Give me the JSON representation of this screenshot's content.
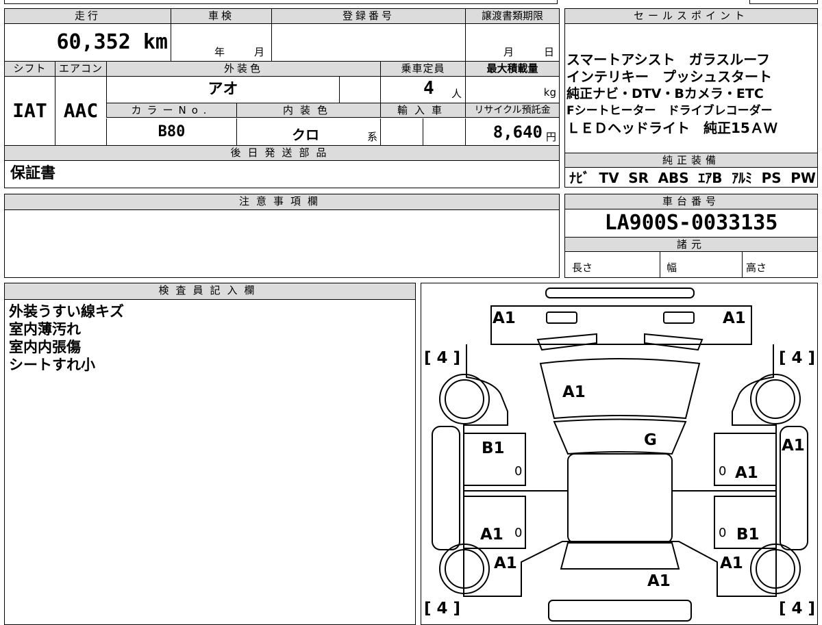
{
  "vehicle": {
    "mileage_label": "走行",
    "mileage": "60,352 km",
    "inspection_label": "車検",
    "inspection_year_unit": "年",
    "inspection_month_unit": "月",
    "registration_label": "登録番号",
    "transfer_deadline_label": "譲渡書類期限",
    "transfer_month_unit": "月",
    "transfer_day_unit": "日",
    "shift_label": "シフト",
    "shift": "IAT",
    "aircon_label": "エアコン",
    "aircon": "AAC",
    "exterior_color_label": "外装色",
    "exterior_color": "アオ",
    "capacity_label": "乗車定員",
    "capacity": "4",
    "capacity_unit": "人",
    "max_load_label": "最大積載量",
    "max_load_unit": "kg",
    "color_no_label": "カラーNo.",
    "color_no": "B80",
    "interior_color_label": "内装色",
    "interior_color": "クロ",
    "interior_color_suffix": "系",
    "import_label": "輸入車",
    "recycle_label": "リサイクル預託金",
    "recycle_fee": "8,640",
    "recycle_unit": "円",
    "later_parts_label": "後日発送部品",
    "later_parts": "保証書"
  },
  "sales_points": {
    "label": "セールスポイント",
    "lines": [
      "スマートアシスト　ガラスルーフ",
      "インテリキー　プッシュスタート",
      "純正ナビ・DTV・Bカメラ・ETC",
      "Fシートヒーター　ドライブレコーダー",
      "ＬＥＤヘッドライト　純正15ＡＷ"
    ]
  },
  "equipment": {
    "label": "純正装備",
    "items": [
      "ﾅﾋﾞ",
      "TV",
      "SR",
      "ABS",
      "ｴｱB",
      "ｱﾙﾐ",
      "PS",
      "PW"
    ]
  },
  "notes": {
    "label": "注意事項欄",
    "text": ""
  },
  "chassis": {
    "label": "車台番号",
    "number": "LA900S-0033135",
    "specs_label": "諸元",
    "length_label": "長さ",
    "width_label": "幅",
    "height_label": "高さ"
  },
  "inspector": {
    "label": "検査員記入欄",
    "lines": [
      "外装うすい線キズ",
      "室内薄汚れ",
      "室内内張傷",
      "シートすれ小"
    ]
  },
  "diagram": {
    "tires": [
      "[ 4 ]",
      "[ 4 ]",
      "[ 4 ]",
      "[ 4 ]"
    ],
    "marks": {
      "front_left": "A1",
      "front_right": "A1",
      "hood": "A1",
      "roof": "G",
      "left_fender": "B1",
      "right_fender": "A1",
      "right_front_door": "A1",
      "left_rear_door": "A1",
      "right_rear_door": "B1",
      "left_rear_qtr": "A1",
      "right_rear_qtr": "A1",
      "rear": "A1",
      "zero": "0"
    }
  }
}
